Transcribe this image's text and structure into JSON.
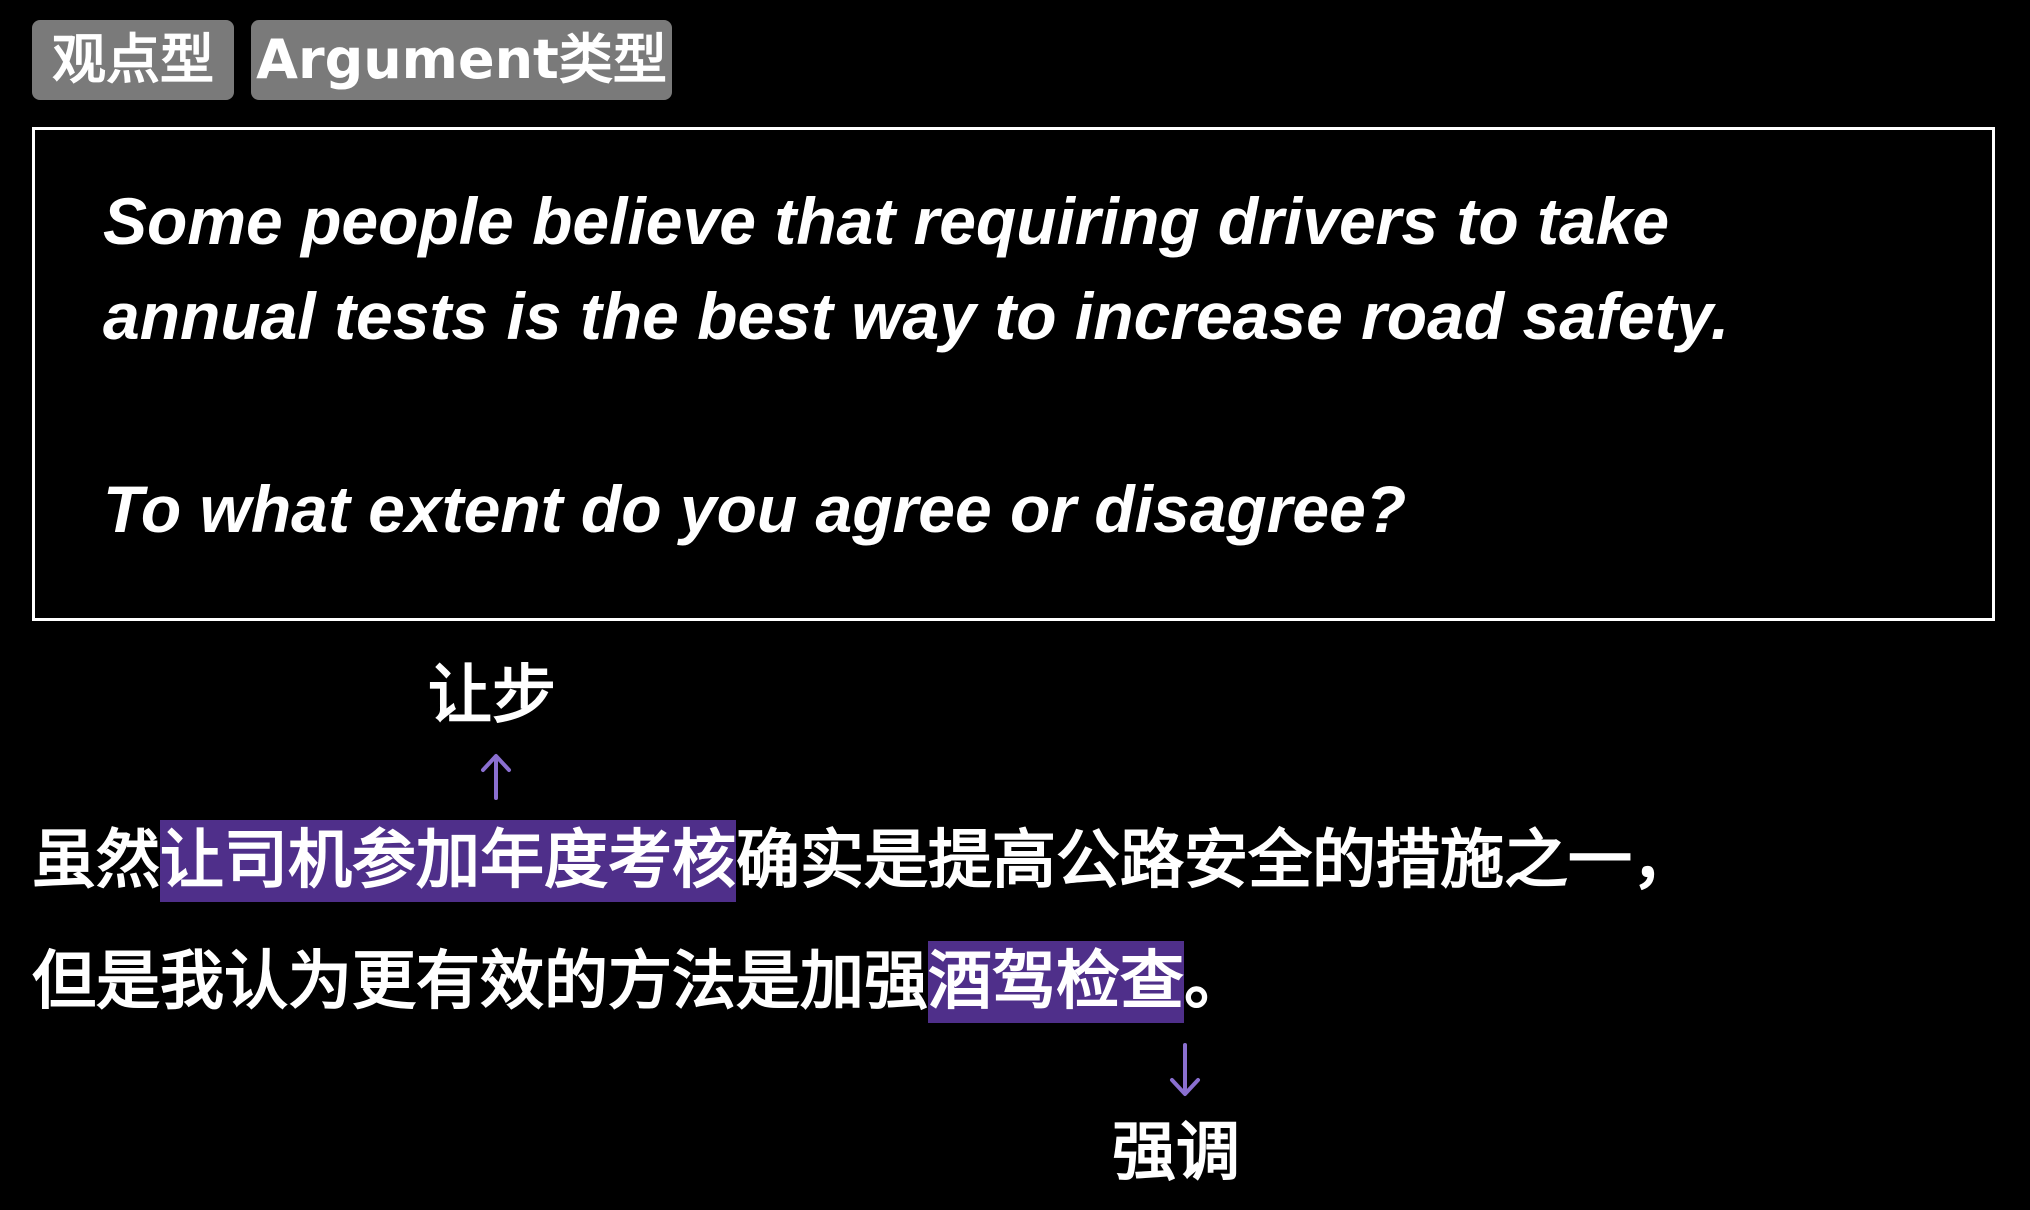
{
  "tags": {
    "type_cn": "观点型",
    "type_en": "Argument类型"
  },
  "question": {
    "line1": "Some people believe that requiring drivers to take",
    "line2": "annual tests is the best way to increase road safety.",
    "line3": "To what extent do you agree or disagree?"
  },
  "annotations": {
    "concession": "让步",
    "emphasis": "强调"
  },
  "answer": {
    "line1_pre": "虽然",
    "line1_highlight": "让司机参加年度考核",
    "line1_post": "确实是提高公路安全的措施之一，",
    "line2_pre": "但是我认为更有效的方法是加强",
    "line2_highlight": "酒驾检查",
    "line2_post": "。"
  },
  "colors": {
    "background": "#000000",
    "tag_background": "#7a7a7a",
    "highlight": "#4f2f8a",
    "arrow": "#8a6fd0"
  },
  "icons": {
    "up": "arrow-up-icon",
    "down": "arrow-down-icon"
  }
}
